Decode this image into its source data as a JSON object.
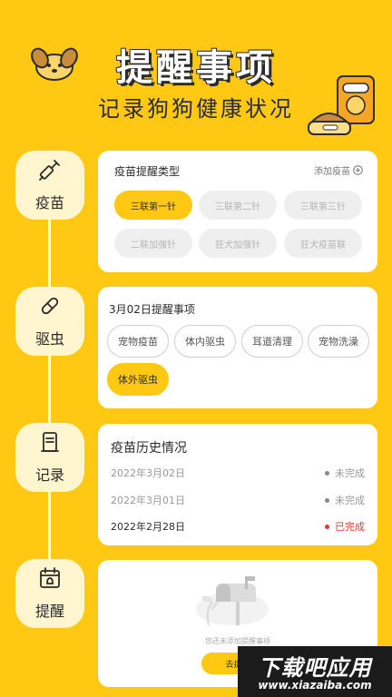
{
  "hero": {
    "title": "提醒事项",
    "subtitle": "记录狗狗健康状况"
  },
  "sidebar": {
    "items": [
      {
        "label": "疫苗",
        "icon": "syringe-icon"
      },
      {
        "label": "驱虫",
        "icon": "pill-icon"
      },
      {
        "label": "记录",
        "icon": "notebook-icon"
      },
      {
        "label": "提醒",
        "icon": "calendar-bell-icon"
      }
    ]
  },
  "vaccine_card": {
    "title": "疫苗提醒类型",
    "add_label": "添加疫苗",
    "options": [
      "三联第一针",
      "三联第二针",
      "三联第三针",
      "二联加强针",
      "狂犬加强针",
      "狂犬疫苗联"
    ],
    "selected": "三联第一针"
  },
  "reminder_card": {
    "title": "3月02日提醒事项",
    "tags": [
      "宠物疫苗",
      "体内驱虫",
      "耳道清理",
      "宠物洗澡",
      "体外驱虫"
    ],
    "selected": "体外驱虫"
  },
  "history_card": {
    "title": "疫苗历史情况",
    "rows": [
      {
        "date": "2022年3月02日",
        "status": "未完成"
      },
      {
        "date": "2022年3月01日",
        "status": "未完成"
      },
      {
        "date": "2022年2月28日",
        "status": "已完成"
      }
    ]
  },
  "empty_card": {
    "message": "您还未添加提醒事项",
    "button_label": "去提醒"
  },
  "watermark": {
    "text": "下载吧应用",
    "url": "www.xiazaiba.com"
  },
  "colors": {
    "brand_yellow": "#FFC812",
    "done_red": "#E53935",
    "pending_grey": "#888888"
  }
}
